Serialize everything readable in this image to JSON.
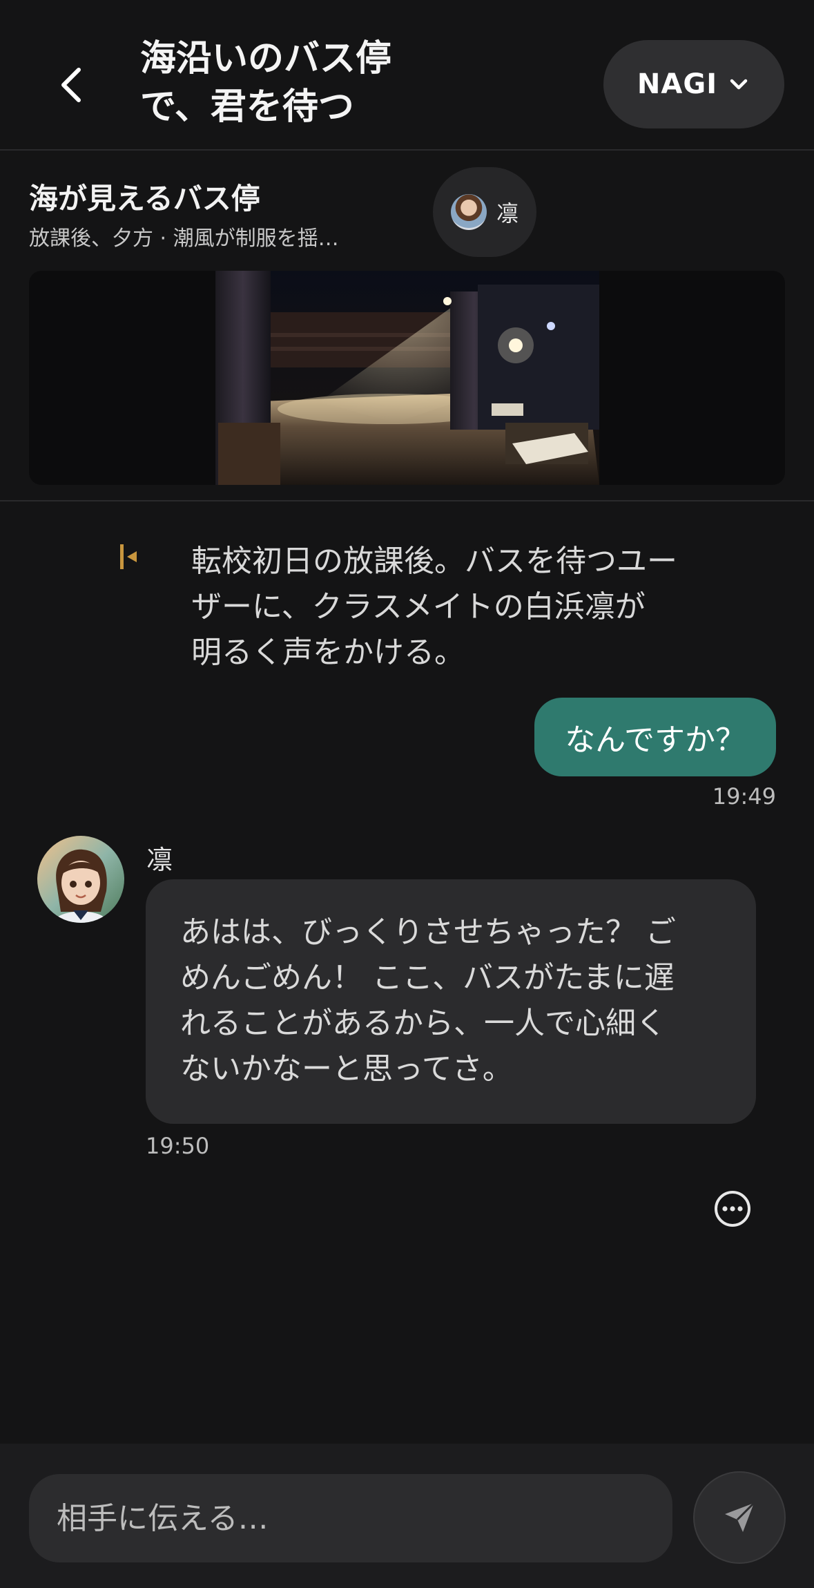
{
  "header": {
    "title": "海沿いのバス停\nで、君を待つ",
    "user_name": "NAGI"
  },
  "scene": {
    "title": "海が見えるバス停",
    "subtitle": "放課後、夕方 · 潮風が制服を揺…",
    "character_chip": "凛"
  },
  "messages": {
    "narration": "転校初日の放課後。バスを待つユー\nザーに、クラスメイトの白浜凛が\n明るく声をかける。",
    "user_message": "なんですか？",
    "user_time": "19:49",
    "character_name": "凛",
    "character_message": "あはは、びっくりさせちゃった？ ご\nめんごめん！ ここ、バスがたまに遅\nれることがあるから、一人で心細く\nないかなーと思ってさ。",
    "character_time": "19:50"
  },
  "composer": {
    "placeholder": "相手に伝える…"
  },
  "icons": {
    "back": "chevron-left-icon",
    "dropdown": "chevron-down-icon",
    "more": "more-icon",
    "send": "send-icon",
    "narration": "narration-marker-icon"
  },
  "colors": {
    "background": "#141415",
    "user_bubble": "#2f7a6e",
    "character_bubble": "#2b2b2d",
    "narration_accent": "#c8963e"
  }
}
